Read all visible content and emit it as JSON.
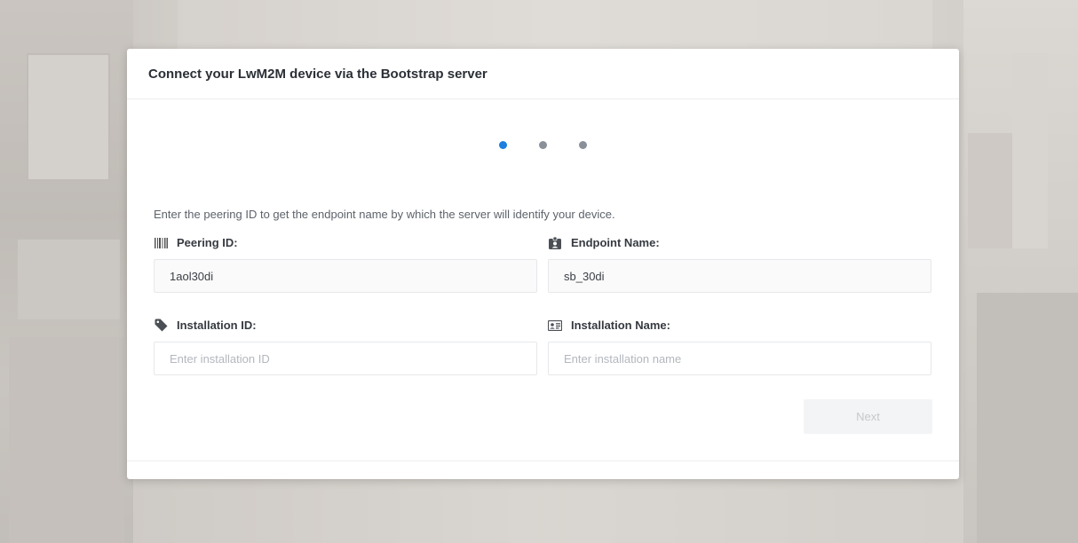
{
  "modal": {
    "title": "Connect your LwM2M device via the Bootstrap server",
    "steps": {
      "total": 3,
      "current": 1
    },
    "description": "Enter the peering ID to get the endpoint name by which the server will identify your device.",
    "fields": {
      "peering_id": {
        "label": "Peering ID:",
        "value": "1aol30di",
        "icon": "barcode-icon"
      },
      "endpoint_name": {
        "label": "Endpoint Name:",
        "value": "sb_30di",
        "icon": "id-badge-icon"
      },
      "installation_id": {
        "label": "Installation ID:",
        "placeholder": "Enter installation ID",
        "icon": "tag-icon"
      },
      "installation_name": {
        "label": "Installation Name:",
        "placeholder": "Enter installation name",
        "icon": "id-card-icon"
      }
    },
    "next_label": "Next"
  },
  "colors": {
    "accent": "#1a7fe0",
    "dot_inactive": "#8a9099",
    "button_disabled_bg": "#f3f4f5",
    "button_disabled_text": "#c5c8cc"
  }
}
